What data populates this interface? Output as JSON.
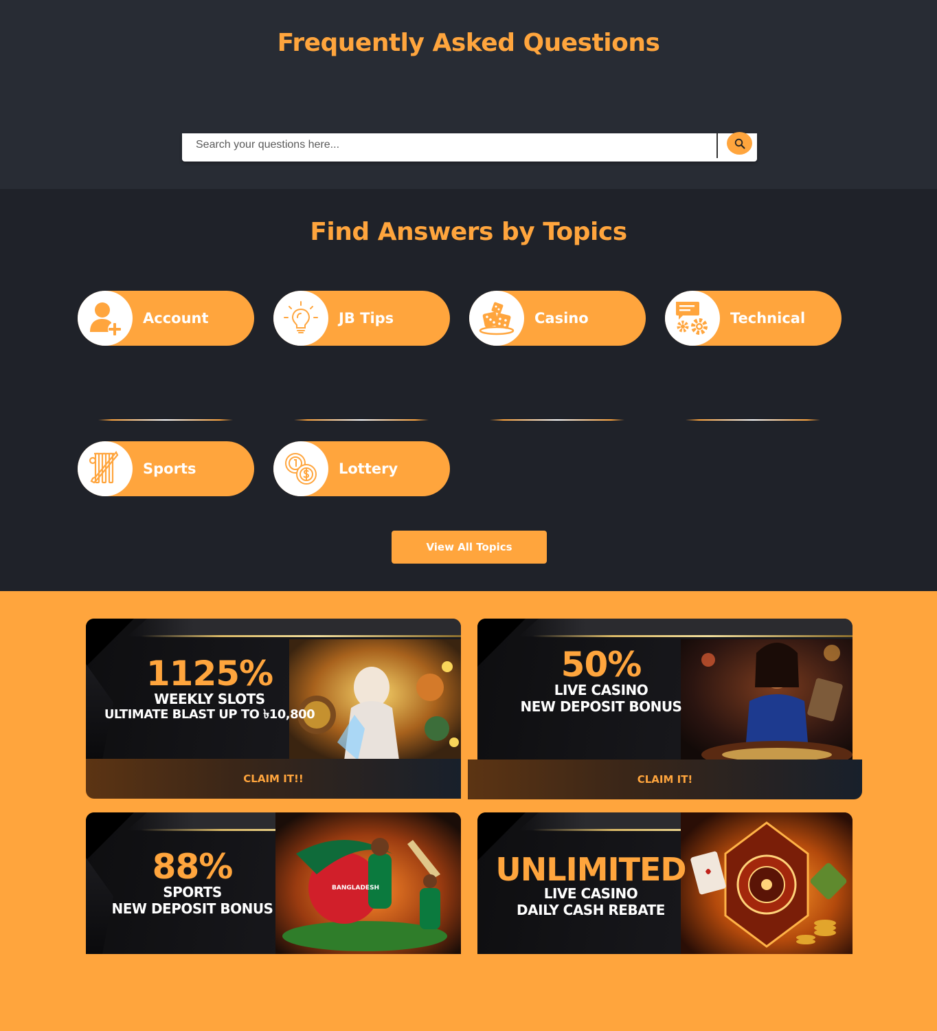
{
  "faq": {
    "title": "Frequently Asked Questions",
    "search_placeholder": "Search your questions here..."
  },
  "topics": {
    "title": "Find Answers by Topics",
    "items": [
      {
        "label": "Account",
        "icon": "account-add-icon"
      },
      {
        "label": "JB Tips",
        "icon": "lightbulb-icon"
      },
      {
        "label": "Casino",
        "icon": "dice-icon"
      },
      {
        "label": "Technical",
        "icon": "gears-chat-icon"
      },
      {
        "label": "Sports",
        "icon": "cricket-icon"
      },
      {
        "label": "Lottery",
        "icon": "coins-icon"
      }
    ],
    "view_all_label": "View All Topics"
  },
  "promotions": [
    {
      "big": "1125%",
      "line1": "WEEKLY SLOTS",
      "line2": "ULTIMATE BLAST UP TO ৳10,800",
      "claim": "CLAIM IT!!"
    },
    {
      "big": "50%",
      "line1": "LIVE CASINO",
      "line2": "NEW DEPOSIT BONUS",
      "claim": "CLAIM IT!"
    },
    {
      "big": "88%",
      "line1": "SPORTS",
      "line2": "NEW DEPOSIT BONUS",
      "badge": "BANGLADESH"
    },
    {
      "big": "UNLIMITED",
      "line1": "LIVE CASINO",
      "line2": "DAILY CASH REBATE"
    }
  ],
  "colors": {
    "accent": "#ffa53d",
    "hero_bg": "#282c34",
    "topics_bg": "#1f2229"
  }
}
